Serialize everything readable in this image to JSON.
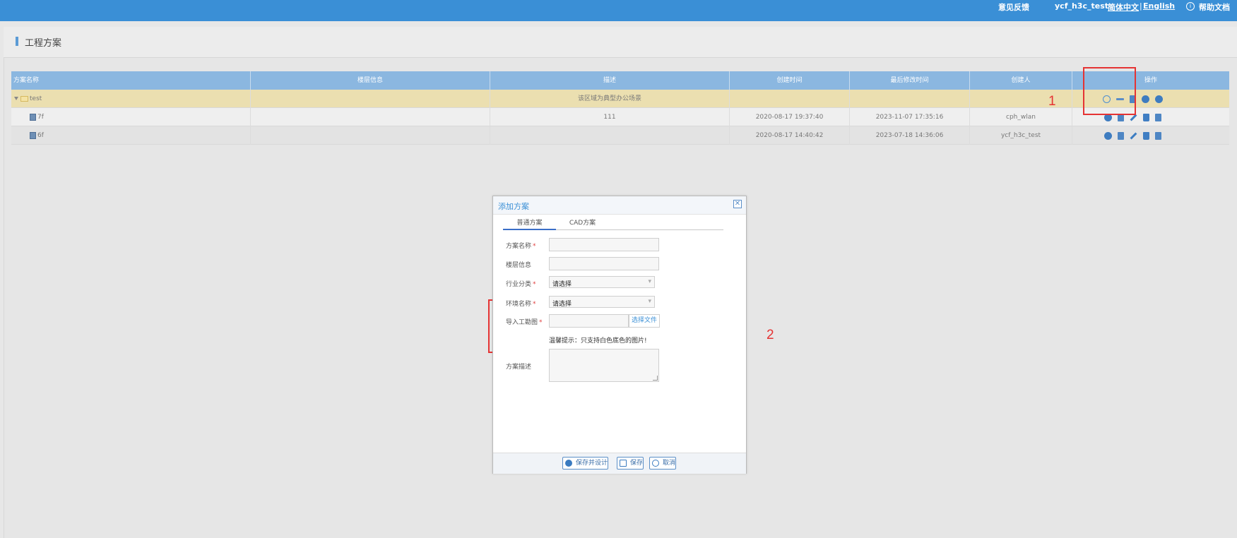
{
  "topbar": {
    "feedback": "意见反馈",
    "user": "ycf_h3c_test",
    "lang_cn": "简体中文",
    "separator": "|",
    "lang_en": "English",
    "help_icon": "i",
    "help": "帮助文档"
  },
  "page": {
    "title": "工程方案"
  },
  "grid": {
    "columns": [
      "方案名称",
      "楼层信息",
      "描述",
      "创建时间",
      "最后修改时间",
      "创建人",
      "操作"
    ],
    "folder": {
      "name": "test",
      "desc": "该区域为典型办公场景"
    },
    "rows": [
      {
        "name": "7f",
        "floor": "",
        "desc": "111",
        "created": "2020-08-17 19:37:40",
        "modified": "2023-11-07 17:35:16",
        "creator": "cph_wlan"
      },
      {
        "name": "6f",
        "floor": "",
        "desc": "",
        "created": "2020-08-17 14:40:42",
        "modified": "2023-07-18 14:36:06",
        "creator": "ycf_h3c_test"
      }
    ]
  },
  "annotations": {
    "label1": "1",
    "label2": "2"
  },
  "dialog": {
    "title": "添加方案",
    "close": "✕",
    "tabs": [
      "普通方案",
      "CAD方案"
    ],
    "fields": {
      "name_label": "方案名称",
      "floor_label": "楼层信息",
      "industry_label": "行业分类",
      "industry_value": "请选择",
      "env_label": "环境名称",
      "env_value": "请选择",
      "import_label": "导入工勘图",
      "file_button": "选择文件",
      "hint": "温馨提示：只支持白色底色的图片!",
      "desc_label": "方案描述",
      "required_mark": "*"
    },
    "buttons": {
      "save_design": "保存并设计",
      "save": "保存",
      "cancel": "取消"
    }
  }
}
